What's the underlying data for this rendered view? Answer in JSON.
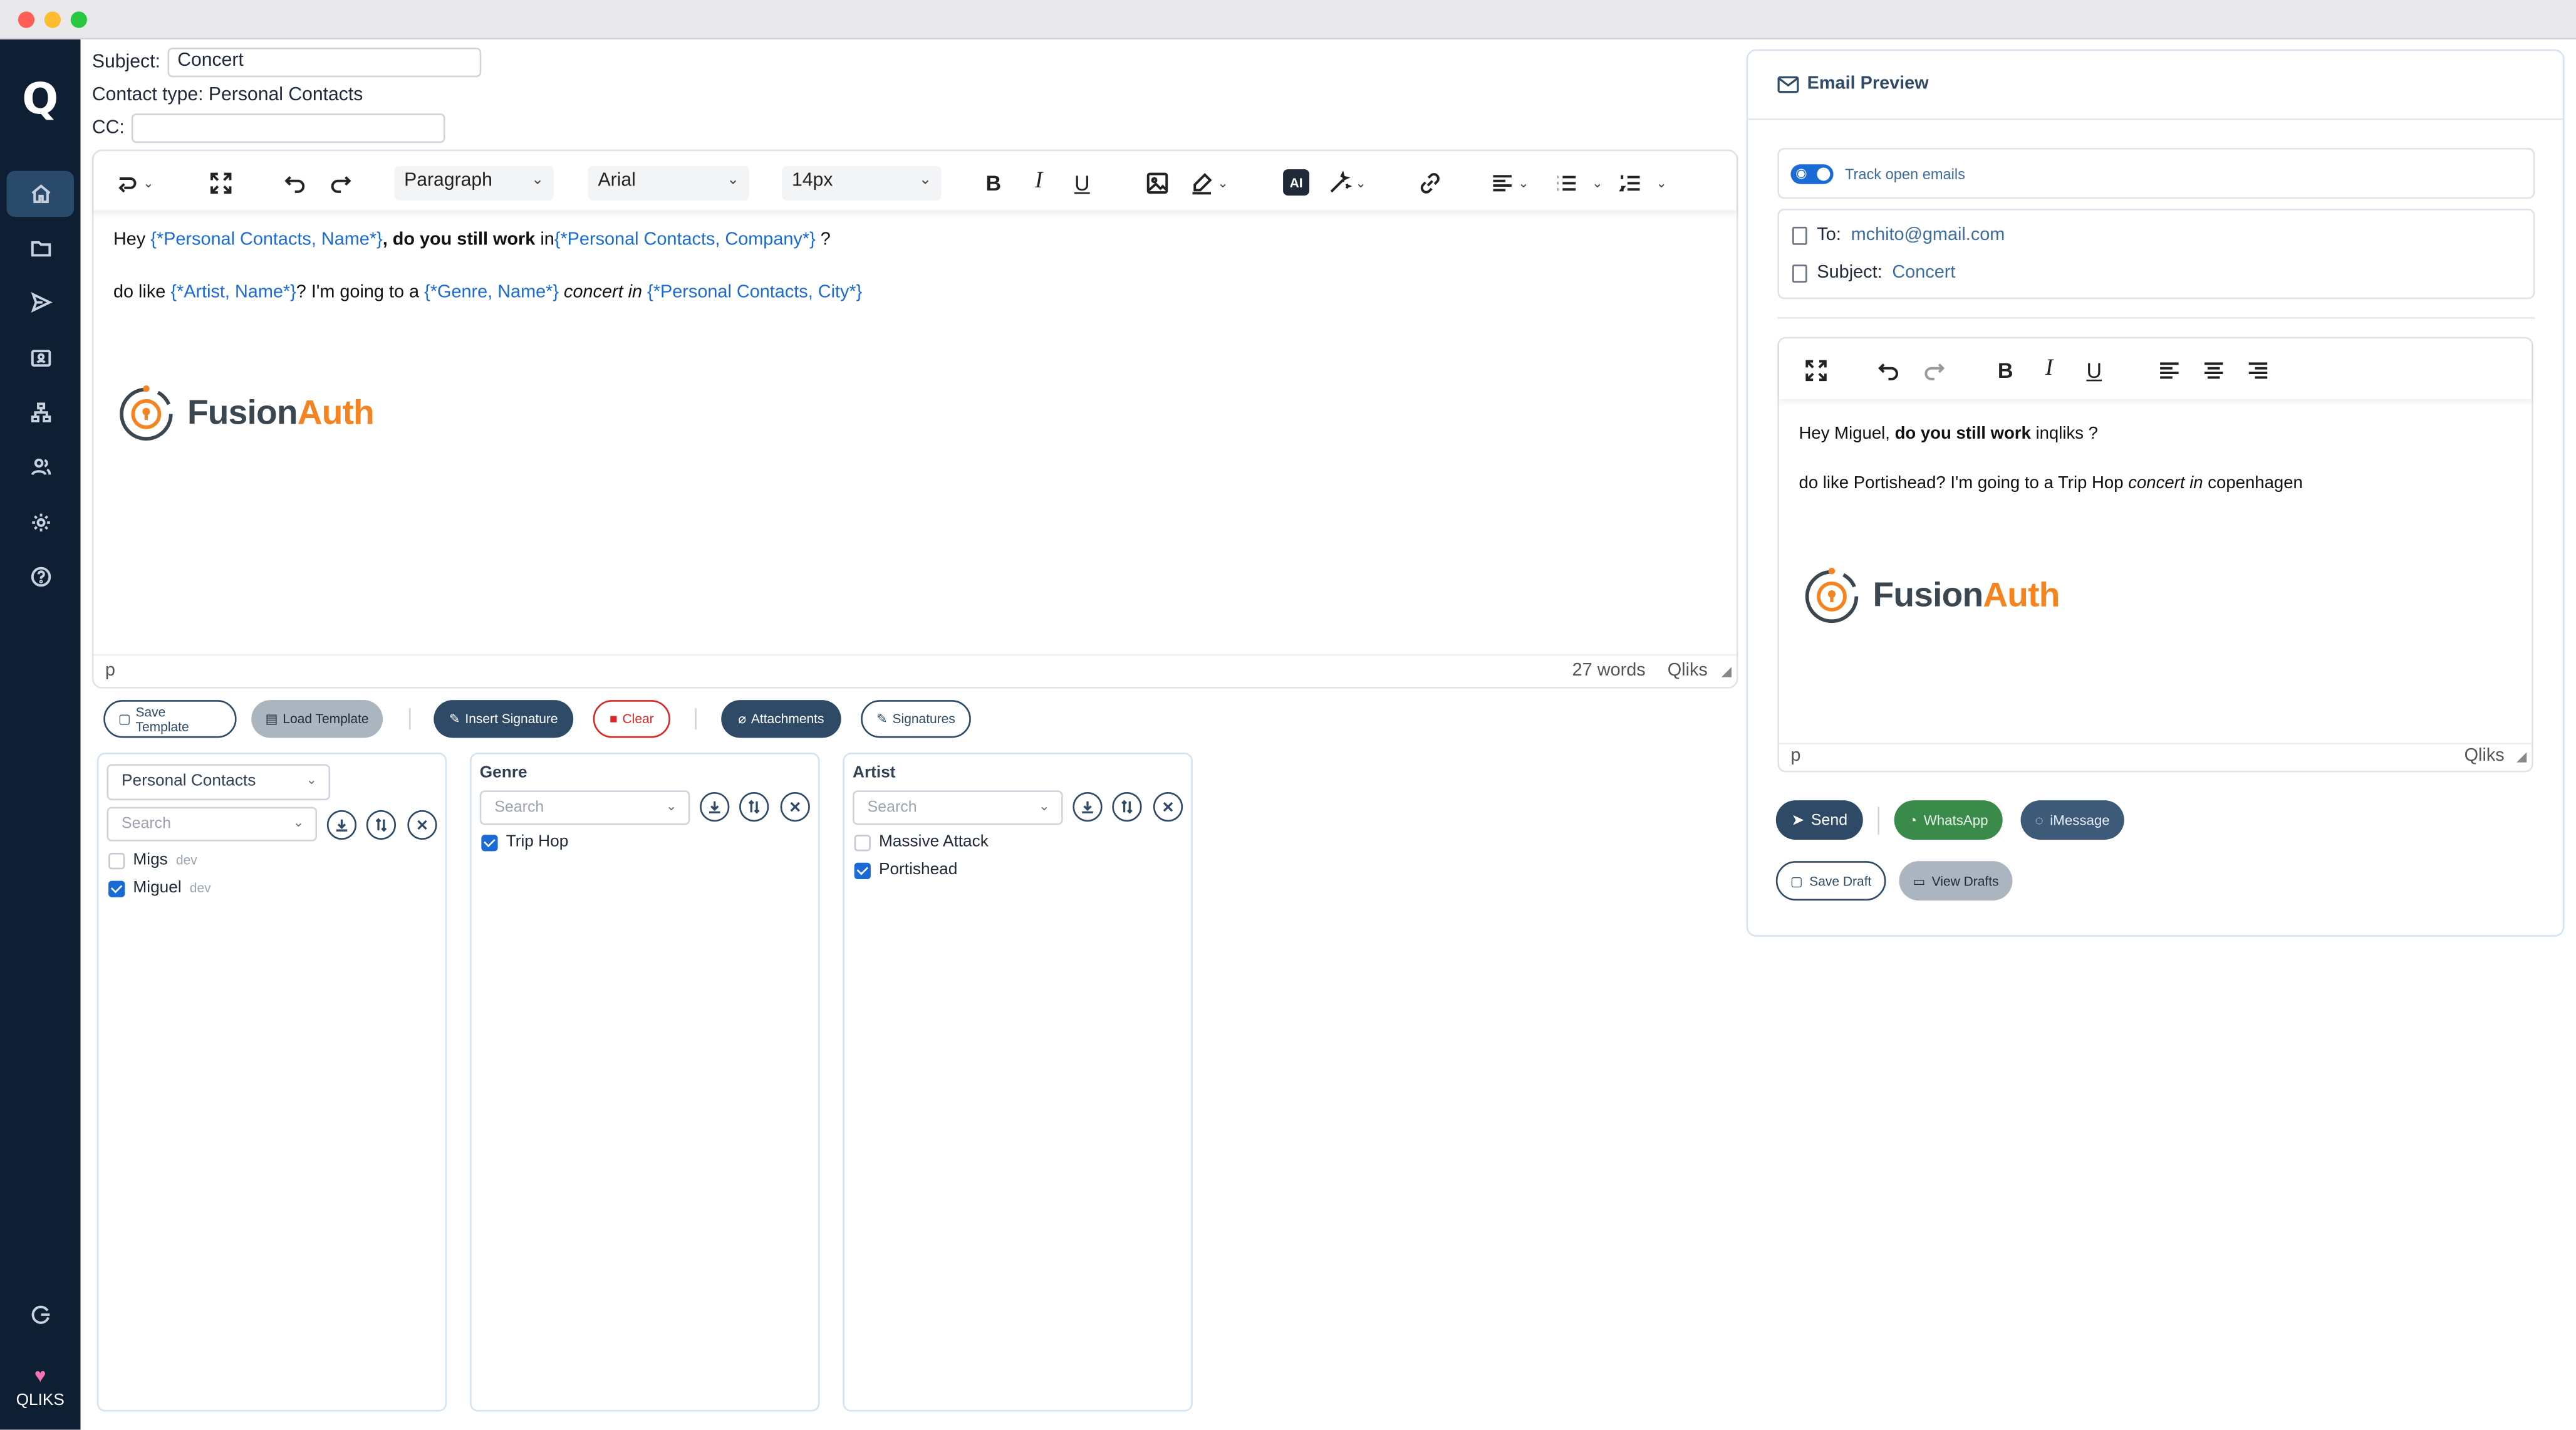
{
  "app": {
    "logo_letter": "Q",
    "brand": "QLIKS"
  },
  "compose": {
    "subject_label": "Subject:",
    "subject_value": "Concert",
    "contact_type_text": "Contact type: Personal Contacts",
    "cc_label": "CC:",
    "cc_value": ""
  },
  "editor": {
    "block_format": "Paragraph",
    "font_family": "Arial",
    "font_size": "14px",
    "ai_label": "AI",
    "body": {
      "l1_hey": "Hey ",
      "l1_tag1": "{*Personal Contacts, Name*}",
      "l1_bold": ", do you still work ",
      "l1_in": "in",
      "l1_tag2": "{*Personal Contacts, Company*}",
      "l1_end": " ?",
      "l2_start": "do like ",
      "l2_tag1": "{*Artist, Name*}",
      "l2_mid": "? I'm going to a ",
      "l2_tag2": "{*Genre, Name*}",
      "l2_italic": " concert in ",
      "l2_tag3": "{*Personal Contacts, City*}"
    },
    "signature": {
      "fusion": "Fusion",
      "auth": "Auth"
    },
    "status_path": "p",
    "word_count": "27 words",
    "status_brand": "Qliks"
  },
  "actions": {
    "save_template": "Save Template",
    "load_template": "Load Template",
    "insert_signature": "Insert Signature",
    "clear": "Clear",
    "attachments": "Attachments",
    "signatures": "Signatures"
  },
  "panels": {
    "contacts": {
      "select_value": "Personal Contacts",
      "search_placeholder": "Search",
      "items": [
        {
          "label": "Migs",
          "sub": "dev",
          "checked": false
        },
        {
          "label": "Miguel",
          "sub": "dev",
          "checked": true
        }
      ]
    },
    "genre": {
      "title": "Genre",
      "search_placeholder": "Search",
      "items": [
        {
          "label": "Trip Hop",
          "checked": true
        }
      ]
    },
    "artist": {
      "title": "Artist",
      "search_placeholder": "Search",
      "items": [
        {
          "label": "Massive Attack",
          "checked": false
        },
        {
          "label": "Portishead",
          "checked": true
        }
      ]
    }
  },
  "preview": {
    "title": "Email Preview",
    "track_label": "Track open emails",
    "track_enabled": true,
    "to_label": "To:",
    "to_value": "mchito@gmail.com",
    "subject_label": "Subject:",
    "subject_value": "Concert",
    "body": {
      "l1_hey": "Hey  Miguel, ",
      "l1_bold": "do you still work",
      "l1_end": " inqliks ?",
      "l2_start": "do like Portishead? I'm going to a Trip Hop ",
      "l2_italic": "concert in",
      "l2_end": " copenhagen"
    },
    "status_path": "p",
    "status_brand": "Qliks",
    "send": "Send",
    "whatsapp": "WhatsApp",
    "imessage": "iMessage",
    "save_draft": "Save Draft",
    "view_drafts": "View Drafts"
  },
  "colors": {
    "sidebar": "#0f1f33",
    "primary": "#2e4a66",
    "link_blue": "#1a6bd6",
    "whatsapp_green": "#3a8a4a",
    "danger": "#dc2626",
    "fusionauth_orange": "#f58320"
  }
}
